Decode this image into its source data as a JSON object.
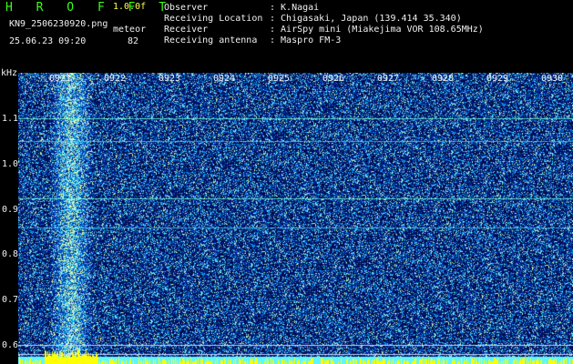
{
  "header": {
    "brand": "H R O F F T",
    "version": "1.0.0f",
    "filename": "KN9_2506230920.png",
    "meteor_label": "meteor",
    "datetime": "25.06.23 09:20",
    "meteor_count": "82"
  },
  "meta": [
    {
      "label": "Observer",
      "value": ": K.Nagai"
    },
    {
      "label": "Receiving Location",
      "value": ": Chigasaki, Japan (139.414 35.340)"
    },
    {
      "label": "Receiver",
      "value": ": AirSpy mini (Miakejima VOR 108.65MHz)"
    },
    {
      "label": "Receiving antenna",
      "value": ": Maspro FM-3"
    }
  ],
  "axes": {
    "y_unit": "kHz",
    "y_ticks": [
      "1.1",
      "1.0",
      "0.9",
      "0.8",
      "0.7",
      "0.6"
    ],
    "x_ticks": [
      "0921",
      "0922",
      "0923",
      "0924",
      "0925",
      "0926",
      "0927",
      "0928",
      "0929",
      "0930"
    ]
  },
  "colors": {
    "background": "#000000",
    "plot_background": "#00052a",
    "text_green": "#39ff14",
    "text_yellow": "#ffff4a",
    "noise_blue": "#1a5cff",
    "trace_cyan": "#5ff5ff",
    "baseline_yellow": "#ffff00"
  },
  "spectrogram": {
    "y_range_khz": [
      0.575,
      1.215
    ],
    "x_range_min": [
      0,
      10
    ],
    "constant_lines_khz": [
      1.115,
      1.066,
      0.94,
      0.875,
      0.617,
      0.597
    ],
    "burst_band_min": [
      0.55,
      1.35
    ]
  }
}
